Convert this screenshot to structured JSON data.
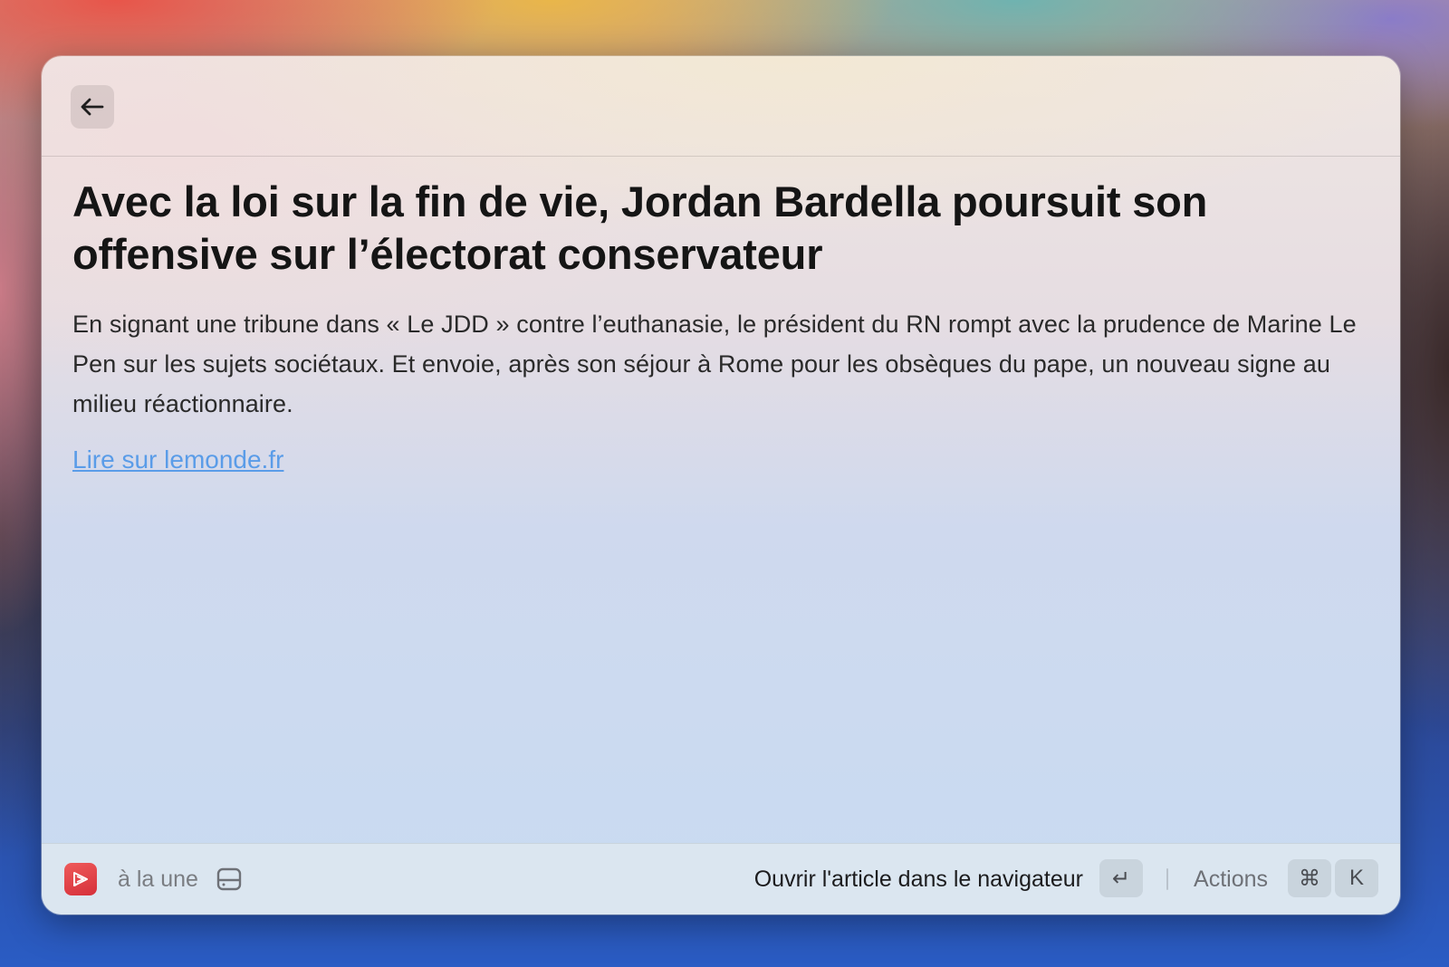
{
  "header": {
    "back_icon": "arrow-left-icon"
  },
  "article": {
    "title": "Avec la loi sur la fin de vie, Jordan Bardella poursuit son offensive sur l’électorat conservateur",
    "summary": "En signant une tribune dans « Le JDD » contre l’euthanasie, le président du RN rompt avec la prudence de Marine Le Pen sur les sujets sociétaux. Et envoie, après son séjour à Rome pour les obsèques du pape, un nouveau signe au milieu réactionnaire.",
    "link_label": "Lire sur lemonde.fr"
  },
  "footer": {
    "app_icon": "news-app-icon",
    "app_icon_color": "#e2414a",
    "source_label": "à la une",
    "tray_icon": "tray-icon",
    "primary_action_label": "Ouvrir l'article dans le navigateur",
    "primary_action_key": "↵",
    "actions_label": "Actions",
    "actions_key_modifier": "⌘",
    "actions_key": "K"
  },
  "colors": {
    "link": "#5a9ce8",
    "title": "#151515"
  }
}
